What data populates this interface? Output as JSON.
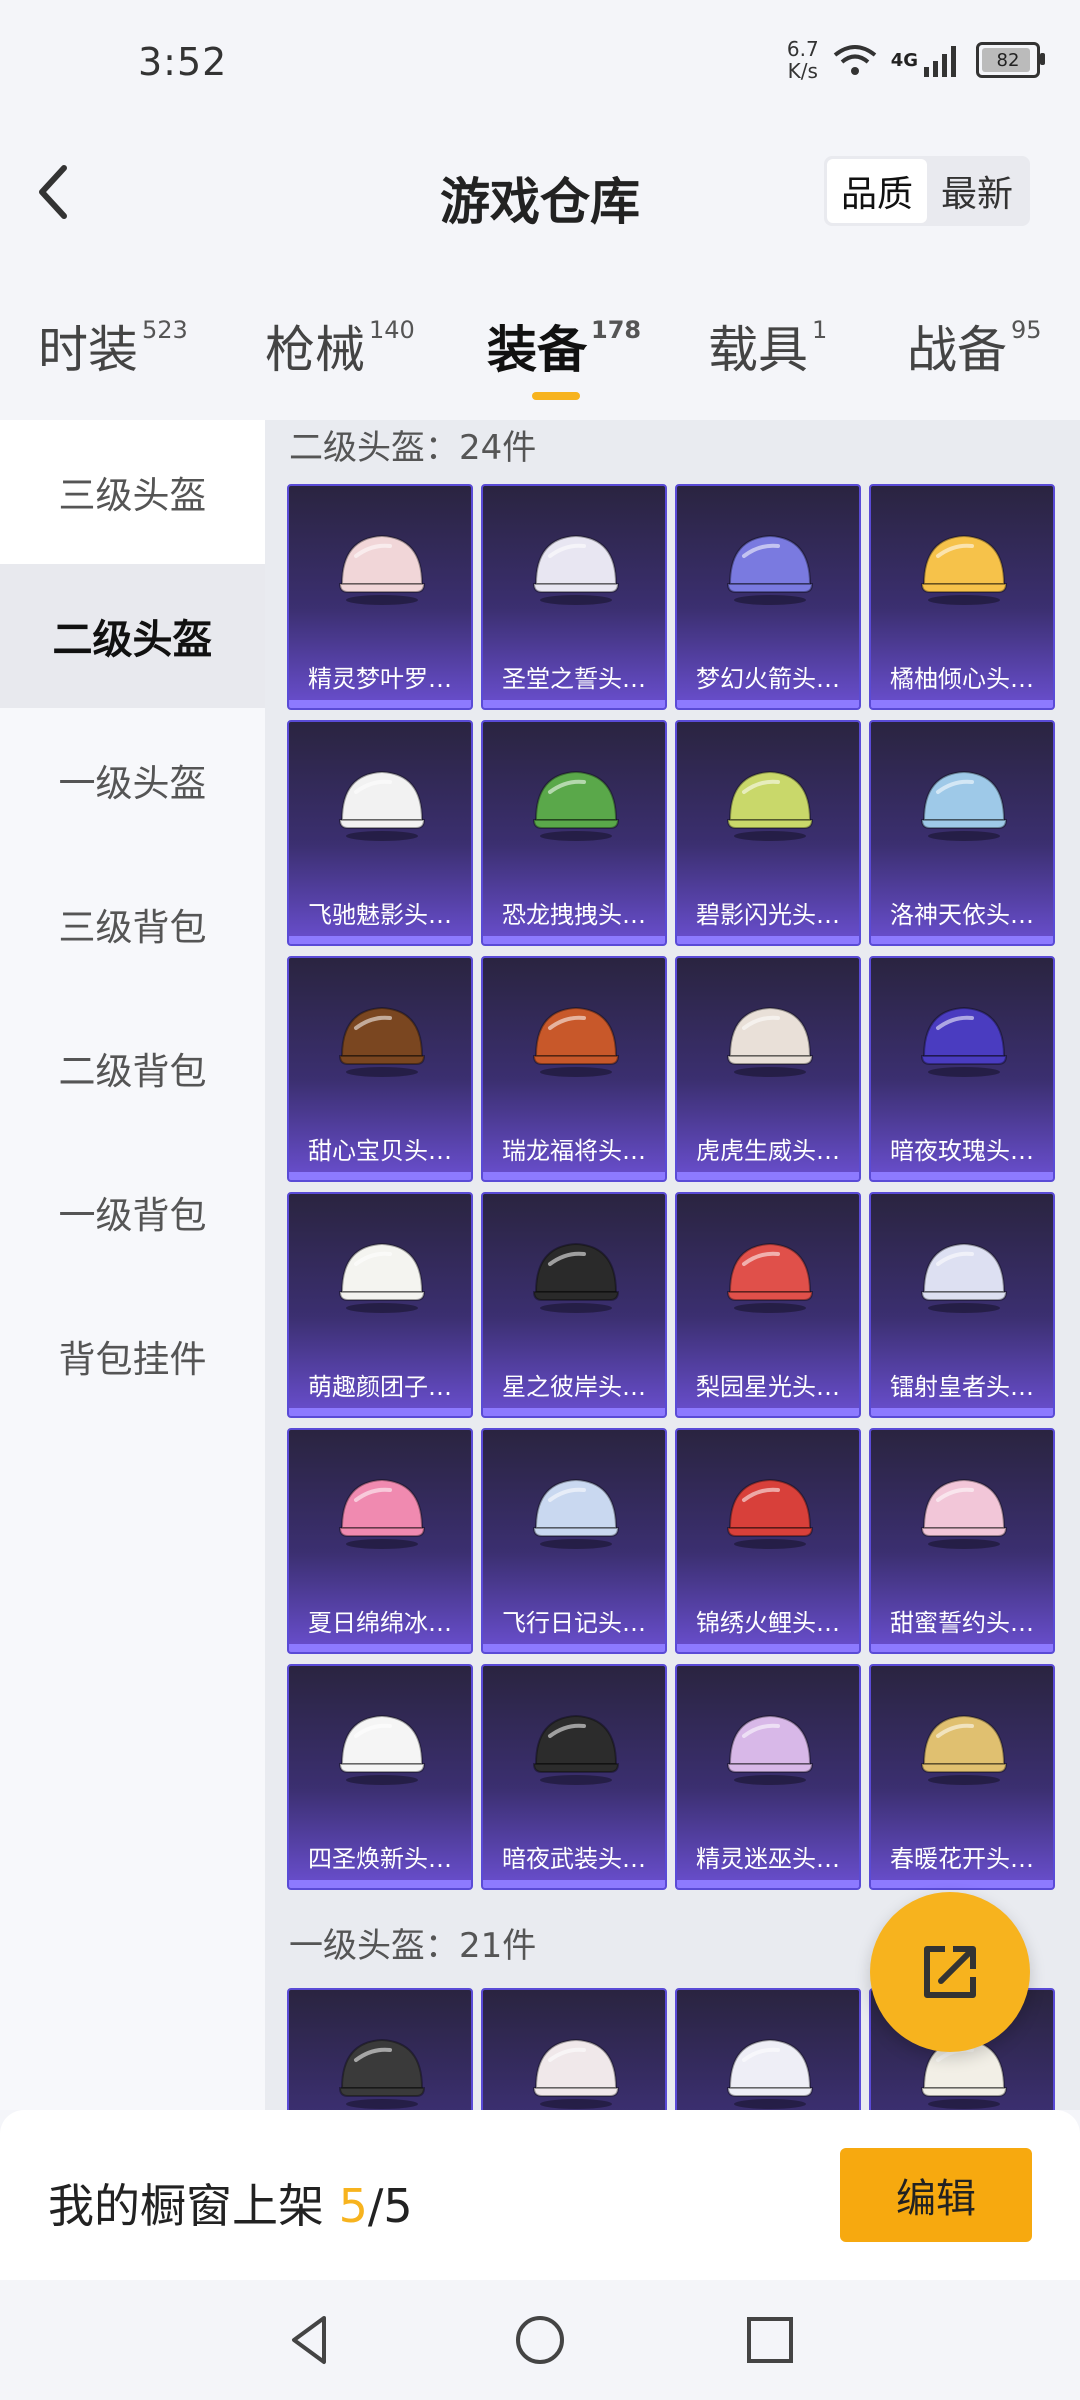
{
  "status": {
    "time": "3:52",
    "net_speed_value": "6.7",
    "net_speed_unit": "K/s",
    "battery": "82",
    "network": "4G"
  },
  "header": {
    "title": "游戏仓库",
    "sort": [
      "品质",
      "最新"
    ]
  },
  "tabs": [
    {
      "label": "时装",
      "count": "523"
    },
    {
      "label": "枪械",
      "count": "140"
    },
    {
      "label": "装备",
      "count": "178"
    },
    {
      "label": "载具",
      "count": "1"
    },
    {
      "label": "战备",
      "count": "95"
    }
  ],
  "sidebar": [
    "三级头盔",
    "二级头盔",
    "一级头盔",
    "三级背包",
    "二级背包",
    "一级背包",
    "背包挂件"
  ],
  "section1": {
    "title": "二级头盔：24件",
    "items": [
      "精灵梦叶罗…",
      "圣堂之誓头…",
      "梦幻火箭头…",
      "橘柚倾心头…",
      "飞驰魅影头…",
      "恐龙拽拽头…",
      "碧影闪光头…",
      "洛神天依头…",
      "甜心宝贝头…",
      "瑞龙福将头…",
      "虎虎生威头…",
      "暗夜玫瑰头…",
      "萌趣颜团子…",
      "星之彼岸头…",
      "梨园星光头…",
      "镭射皇者头…",
      "夏日绵绵冰…",
      "飞行日记头…",
      "锦绣火鲤头…",
      "甜蜜誓约头…",
      "四圣焕新头…",
      "暗夜武装头…",
      "精灵迷巫头…",
      "春暖花开头…"
    ]
  },
  "section2": {
    "title": "一级头盔：21件"
  },
  "helmet_colors": [
    "#f1d6d8",
    "#e8e6f2",
    "#7a7ae0",
    "#f6c24a",
    "#f2f2f2",
    "#5aa84a",
    "#c9d86a",
    "#9ec9e8",
    "#7a4620",
    "#c8582a",
    "#e9e0d8",
    "#4a3cc0",
    "#f4f4f0",
    "#2a2a2a",
    "#e0504a",
    "#dde0f2",
    "#f08ab0",
    "#c9d8f0",
    "#d8403a",
    "#f2c6d8",
    "#f5f5f5",
    "#2c2c2c",
    "#d8b8e8",
    "#e0c070"
  ],
  "bottom": {
    "label": "我的橱窗上架",
    "current": "5",
    "total": "/5",
    "edit": "编辑"
  },
  "accent": "#f7b31e"
}
